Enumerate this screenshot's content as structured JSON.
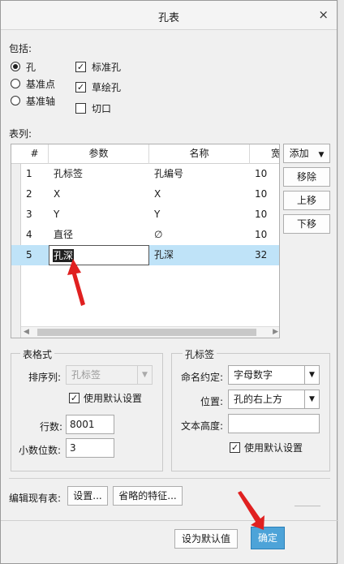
{
  "window": {
    "title": "孔表",
    "close": "×"
  },
  "include": {
    "label": "包括:",
    "radios": [
      {
        "label": "孔",
        "selected": true
      },
      {
        "label": "基准点",
        "selected": false
      },
      {
        "label": "基准轴",
        "selected": false
      }
    ],
    "checks": [
      {
        "label": "标准孔",
        "checked": true
      },
      {
        "label": "草绘孔",
        "checked": true
      },
      {
        "label": "切口",
        "checked": false
      }
    ]
  },
  "columns_label": "表列:",
  "table": {
    "headers": [
      "#",
      "参数",
      "名称",
      "宽"
    ],
    "rows": [
      {
        "n": "1",
        "param": "孔标签",
        "name": "孔编号",
        "width": "10"
      },
      {
        "n": "2",
        "param": "X",
        "name": "X",
        "width": "10"
      },
      {
        "n": "3",
        "param": "Y",
        "name": "Y",
        "width": "10"
      },
      {
        "n": "4",
        "param": "直径",
        "name": "∅",
        "width": "10"
      },
      {
        "n": "5",
        "param": "孔深",
        "name": "孔深",
        "width": "32"
      }
    ]
  },
  "side_buttons": {
    "add": "添加",
    "remove": "移除",
    "up": "上移",
    "down": "下移"
  },
  "table_format": {
    "title": "表格式",
    "sort_label": "排序列:",
    "sort_value": "孔标签",
    "use_default": "使用默认设置",
    "rows_label": "行数:",
    "rows_value": "8001",
    "decimals_label": "小数位数:",
    "decimals_value": "3"
  },
  "hole_label": {
    "title": "孔标签",
    "naming_label": "命名约定:",
    "naming_value": "字母数字",
    "position_label": "位置:",
    "position_value": "孔的右上方",
    "text_height_label": "文本高度:",
    "text_height_value": "",
    "use_default": "使用默认设置"
  },
  "edit_existing": {
    "label": "编辑现有表:",
    "settings": "设置...",
    "omitted": "省略的特征..."
  },
  "footer": {
    "set_default": "设为默认值",
    "ok": "确定"
  },
  "colors": {
    "selection": "#bfe3f8",
    "ok_button": "#4da3d8",
    "arrow": "#e02020"
  }
}
